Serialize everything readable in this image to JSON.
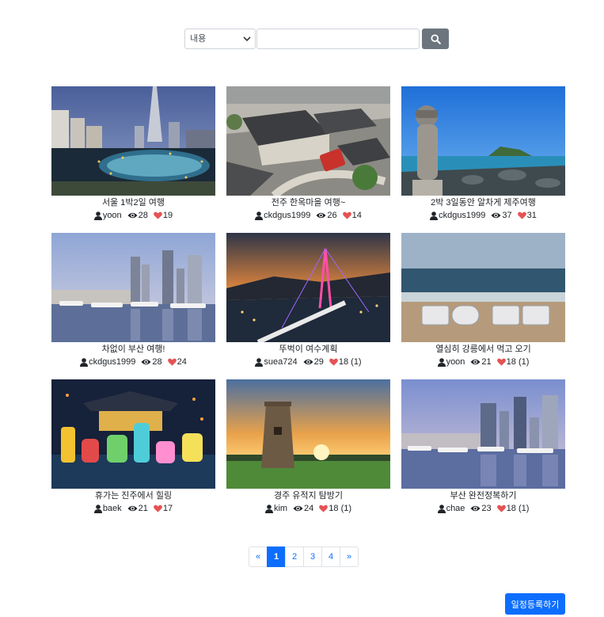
{
  "search": {
    "select_value": "내용",
    "input_value": "",
    "button_icon": "search-icon"
  },
  "posts": [
    {
      "title": "서울 1박2일 여행",
      "user": "yoon",
      "views": "28",
      "likes": "19"
    },
    {
      "title": "전주 한옥마을 여행~",
      "user": "ckdgus1999",
      "views": "26",
      "likes": "14"
    },
    {
      "title": "2박 3일동안 알차게 제주여행",
      "user": "ckdgus1999",
      "views": "37",
      "likes": "31"
    },
    {
      "title": "차없이 부산 여행!",
      "user": "ckdgus1999",
      "views": "28",
      "likes": "24"
    },
    {
      "title": "뚜벅이 여수계획",
      "user": "suea724",
      "views": "29",
      "likes": "18 (1)"
    },
    {
      "title": "열심히 강릉에서 먹고 오기",
      "user": "yoon",
      "views": "21",
      "likes": "18 (1)"
    },
    {
      "title": "휴가는 진주에서 힐링",
      "user": "baek",
      "views": "21",
      "likes": "17"
    },
    {
      "title": "경주 유적지 탐방기",
      "user": "kim",
      "views": "24",
      "likes": "18 (1)"
    },
    {
      "title": "부산 완전정복하기",
      "user": "chae",
      "views": "23",
      "likes": "18 (1)"
    }
  ],
  "pagination": {
    "prev": "«",
    "pages": [
      "1",
      "2",
      "3",
      "4"
    ],
    "active": "1",
    "next": "»"
  },
  "register_button": "일정등록하기",
  "colors": {
    "primary": "#0d6efd",
    "search_button": "#6c757d",
    "heart": "#e55353"
  }
}
